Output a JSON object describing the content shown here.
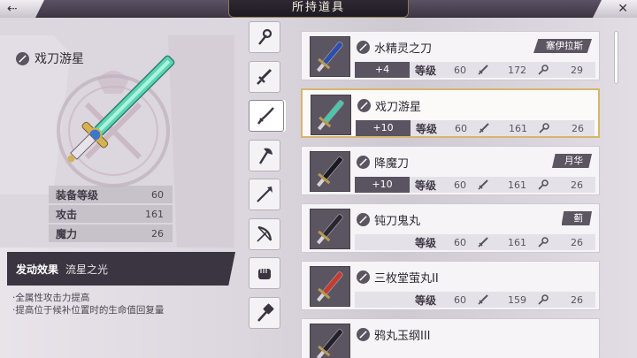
{
  "header": {
    "back_label": "⇠",
    "title": "所持道具",
    "close_label": "✕"
  },
  "detail": {
    "name": "戏刀游星",
    "stats": [
      {
        "label": "装备等级",
        "value": "60"
      },
      {
        "label": "攻击",
        "value": "161"
      },
      {
        "label": "魔力",
        "value": "26"
      }
    ],
    "skill": {
      "label": "发动效果",
      "value": "流星之光"
    },
    "notes": [
      "·全属性攻击力提高",
      "·提高位于候补位置时的生命值回复量"
    ]
  },
  "categories": [
    "staff",
    "sword",
    "katana",
    "axe",
    "spear",
    "bow",
    "fist",
    "hammer"
  ],
  "selected_category": "katana",
  "items": [
    {
      "name": "水精灵之刀",
      "badge": "塞伊拉斯",
      "plus": "+4",
      "level_label": "等级",
      "level": "60",
      "attack": "172",
      "magic": "29",
      "blade_color": "#2a4fb0",
      "selected": false
    },
    {
      "name": "戏刀游星",
      "badge": "",
      "plus": "+10",
      "level_label": "等级",
      "level": "60",
      "attack": "161",
      "magic": "26",
      "blade_color": "#48c8a8",
      "selected": true
    },
    {
      "name": "降魔刀",
      "badge": "月华",
      "plus": "+10",
      "level_label": "等级",
      "level": "60",
      "attack": "161",
      "magic": "26",
      "blade_color": "#1a1820",
      "selected": false
    },
    {
      "name": "钝刀鬼丸",
      "badge": "蓟",
      "plus": "",
      "level_label": "等级",
      "level": "60",
      "attack": "161",
      "magic": "26",
      "blade_color": "#2a2630",
      "selected": false
    },
    {
      "name": "三枚堂萤丸II",
      "badge": "",
      "plus": "",
      "level_label": "等级",
      "level": "60",
      "attack": "159",
      "magic": "26",
      "blade_color": "#c83a30",
      "selected": false
    },
    {
      "name": "鸦丸玉纲III",
      "badge": "",
      "plus": "",
      "level_label": "等级",
      "level": "",
      "attack": "",
      "magic": "",
      "blade_color": "#222028",
      "selected": false
    }
  ],
  "colors": {
    "accent_gold": "#d6b66c",
    "dark_panel": "#3b3541"
  }
}
